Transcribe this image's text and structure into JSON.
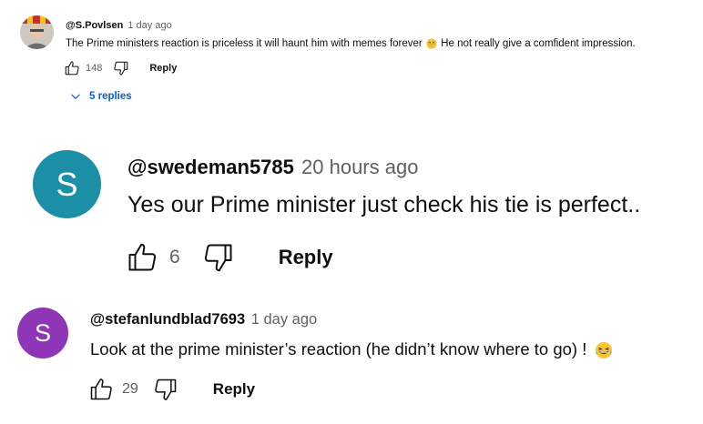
{
  "comments": [
    {
      "author": "@S.Povlsen",
      "time": "1 day ago",
      "text": "The Prime ministers reaction is priceless it will haunt him with memes forever",
      "text_after_emoji": "He not really give a comfident impression.",
      "likes": "148",
      "reply_label": "Reply",
      "replies_label": "5 replies",
      "avatar_icon": "user-photo-avatar"
    },
    {
      "author": "@swedeman5785",
      "time": "20 hours ago",
      "text": "Yes our Prime minister just check his tie is perfect..",
      "likes": "6",
      "reply_label": "Reply",
      "avatar_letter": "S",
      "avatar_color": "#1a8fa6"
    },
    {
      "author": "@stefanlundblad7693",
      "time": "1 day ago",
      "text": "Look at the prime minister’s reaction (he didn’t know where to go) !",
      "likes": "29",
      "reply_label": "Reply",
      "avatar_letter": "S",
      "avatar_color": "#8e35b8"
    }
  ],
  "icons": {
    "like": "thumbs-up-icon",
    "dislike": "thumbs-down-icon",
    "expand": "chevron-down-icon",
    "emoji_grin": "grinning-emoji",
    "emoji_laugh": "laughing-tears-emoji"
  },
  "colors": {
    "link_blue": "#065fd4",
    "meta_gray": "#606060"
  }
}
